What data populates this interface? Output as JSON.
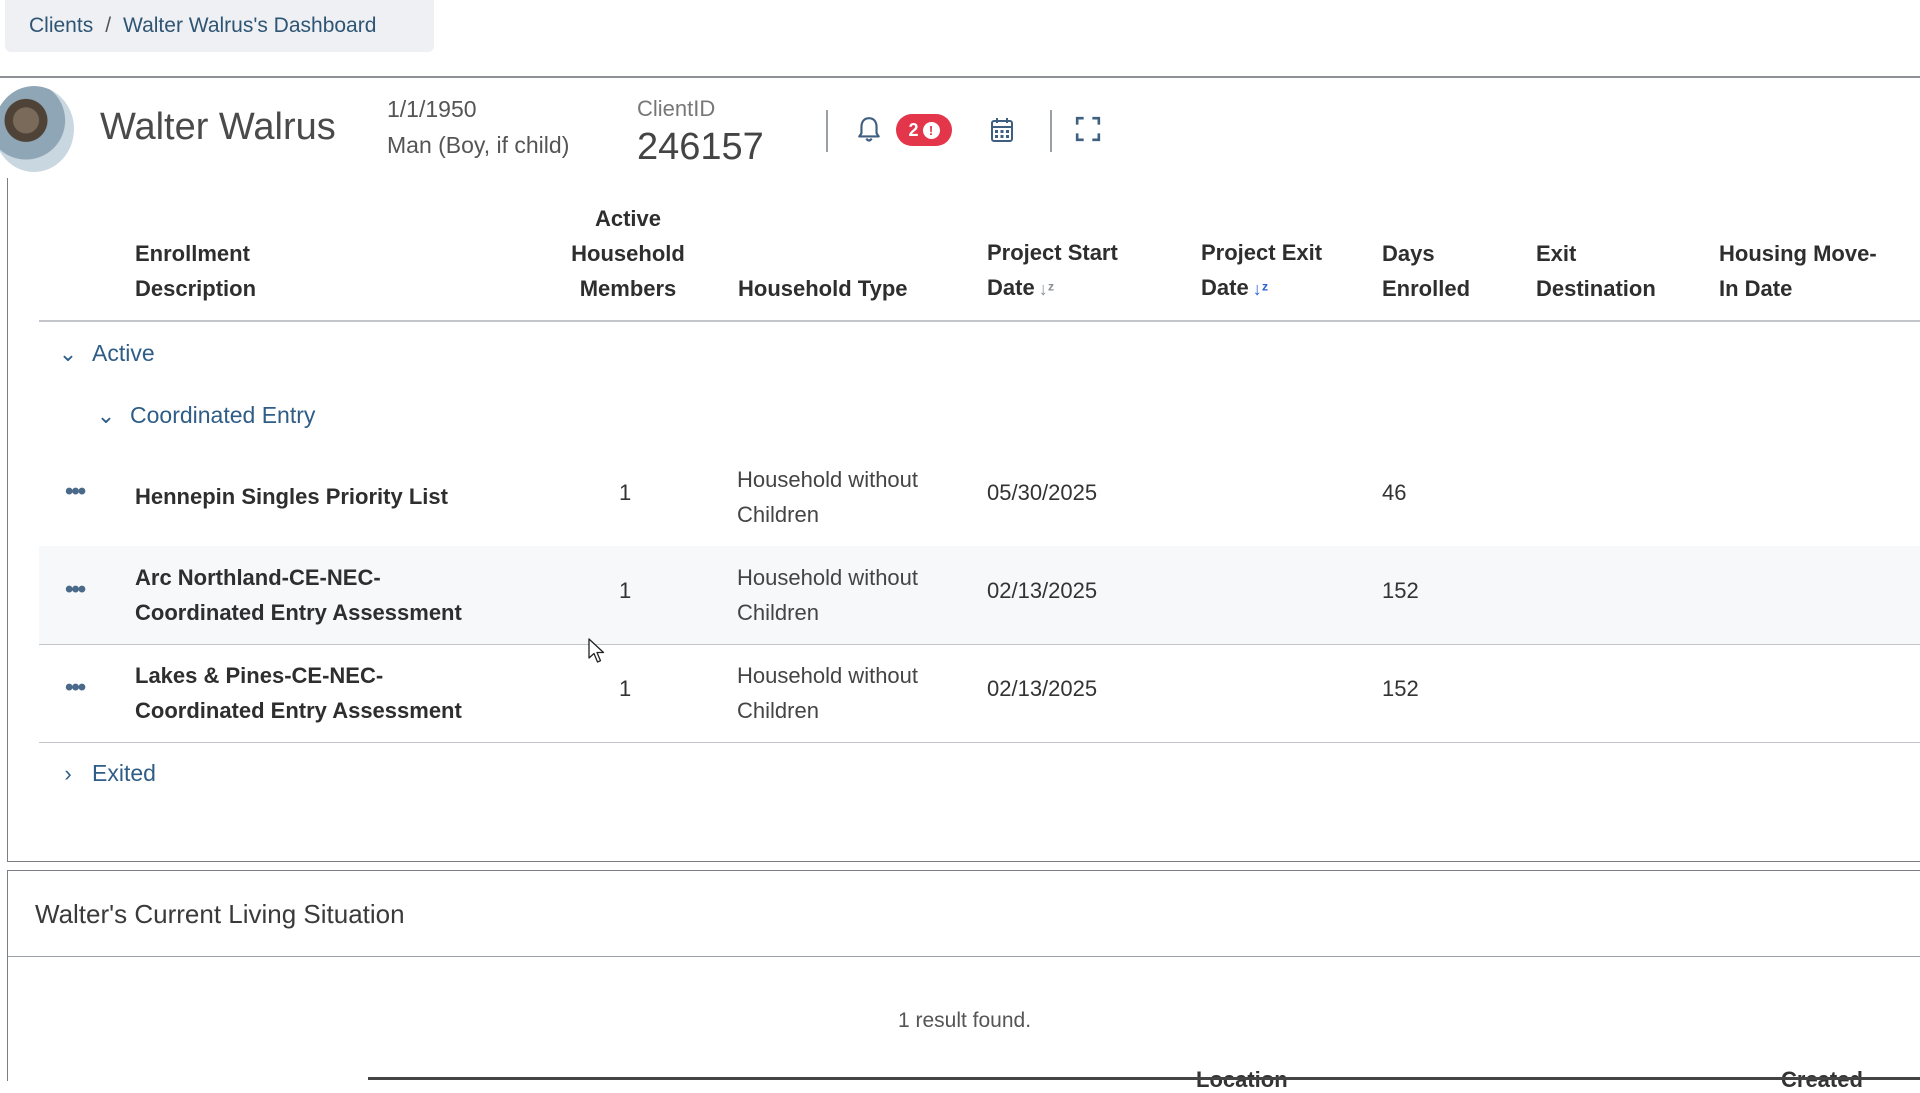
{
  "breadcrumb": {
    "root": "Clients",
    "separator": "/",
    "current": "Walter Walrus's Dashboard"
  },
  "client": {
    "name": "Walter Walrus",
    "dob": "1/1/1950",
    "gender": "Man (Boy, if child)",
    "client_id_label": "ClientID",
    "client_id": "246157"
  },
  "toolbar": {
    "notification_count": "2",
    "alert_glyph": "!",
    "icons": [
      "bell-icon",
      "calendar-icon",
      "expand-icon"
    ],
    "badge_color": "#e4364a"
  },
  "table": {
    "headers": {
      "description": [
        "Enrollment",
        "Description"
      ],
      "members": [
        "Active",
        "Household",
        "Members"
      ],
      "household_type": "Household Type",
      "start": [
        "Project Start",
        "Date"
      ],
      "exit": [
        "Project Exit",
        "Date"
      ],
      "days": [
        "Days",
        "Enrolled"
      ],
      "destination": [
        "Exit",
        "Destination"
      ],
      "move_in": [
        "Housing Move-",
        "In Date"
      ]
    },
    "groups": {
      "active": "Active",
      "coordinated_entry": "Coordinated Entry",
      "exited": "Exited"
    },
    "rows": [
      {
        "description": [
          "Hennepin Singles Priority List"
        ],
        "members": "1",
        "household_type": [
          "Household without",
          "Children"
        ],
        "start": "05/30/2025",
        "days": "46"
      },
      {
        "description": [
          "Arc Northland-CE-NEC-",
          "Coordinated Entry Assessment"
        ],
        "members": "1",
        "household_type": [
          "Household without",
          "Children"
        ],
        "start": "02/13/2025",
        "days": "152"
      },
      {
        "description": [
          "Lakes & Pines-CE-NEC-",
          "Coordinated Entry Assessment"
        ],
        "members": "1",
        "household_type": [
          "Household without",
          "Children"
        ],
        "start": "02/13/2025",
        "days": "152"
      }
    ],
    "accent_color": "#2f5d87"
  },
  "living_situation": {
    "title": "Walter's Current Living Situation",
    "result_count": "1 result found.",
    "columns": [
      "Location",
      "Created"
    ]
  }
}
